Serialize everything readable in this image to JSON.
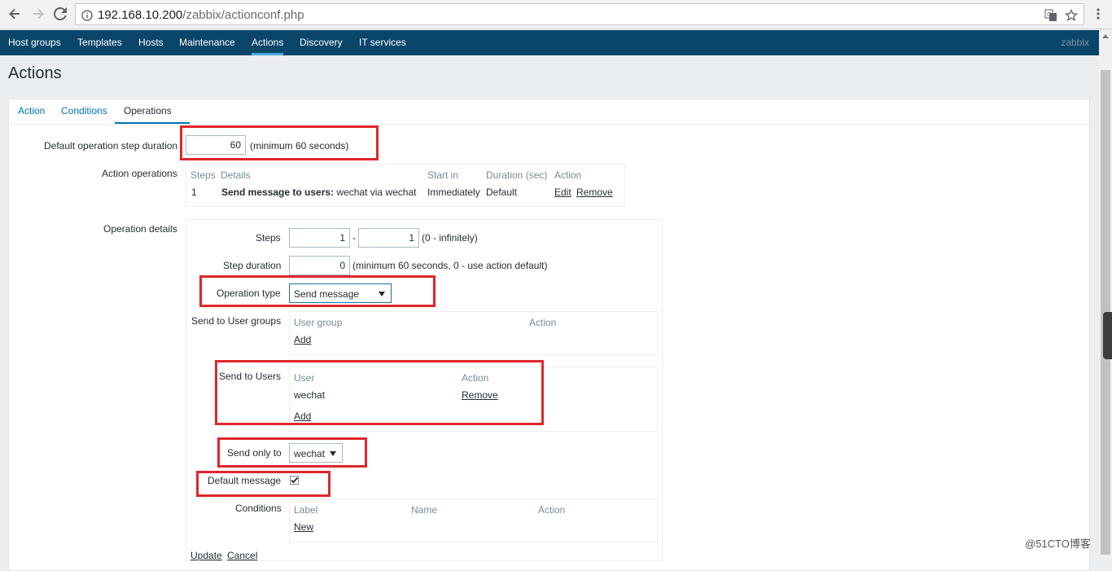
{
  "browser": {
    "url_domain": "192.168.10.200",
    "url_path": "/zabbix/actionconf.php"
  },
  "topnav": {
    "items": [
      "Host groups",
      "Templates",
      "Hosts",
      "Maintenance",
      "Actions",
      "Discovery",
      "IT services"
    ],
    "active": "Actions",
    "brand": "zabbix"
  },
  "page": {
    "title": "Actions"
  },
  "tabs": [
    "Action",
    "Conditions",
    "Operations"
  ],
  "form": {
    "step_duration_label": "Default operation step duration",
    "step_duration_value": "60",
    "step_duration_hint": "(minimum 60 seconds)",
    "action_operations_label": "Action operations",
    "ops_table": {
      "headers": [
        "Steps",
        "Details",
        "Start in",
        "Duration (sec)",
        "Action"
      ],
      "row": {
        "steps": "1",
        "details_bold": "Send message to users:",
        "details_rest": " wechat via wechat",
        "start_in": "Immediately",
        "duration": "Default",
        "edit": "Edit",
        "remove": "Remove"
      }
    },
    "operation_details_label": "Operation details",
    "steps_label": "Steps",
    "steps_from": "1",
    "steps_sep": "-",
    "steps_to": "1",
    "steps_hint": "(0 - infinitely)",
    "op_step_duration_label": "Step duration",
    "op_step_duration_value": "0",
    "op_step_duration_hint": "(minimum 60 seconds, 0 - use action default)",
    "operation_type_label": "Operation type",
    "operation_type_value": "Send message",
    "user_groups_label": "Send to User groups",
    "user_groups_headers": [
      "User group",
      "Action"
    ],
    "user_groups_add": "Add",
    "users_label": "Send to Users",
    "users_headers": [
      "User",
      "Action"
    ],
    "users_row": {
      "user": "wechat",
      "remove": "Remove"
    },
    "users_add": "Add",
    "send_only_to_label": "Send only to",
    "send_only_to_value": "wechat",
    "default_message_label": "Default message",
    "default_message_checked": true,
    "conditions_label": "Conditions",
    "conditions_headers": [
      "Label",
      "Name",
      "Action"
    ],
    "conditions_new": "New",
    "update": "Update",
    "cancel": "Cancel"
  },
  "watermark": "@51CTO博客",
  "colors": {
    "nav_bg": "#0a466a",
    "link": "#0275b8",
    "highlight": "#e0262c"
  }
}
